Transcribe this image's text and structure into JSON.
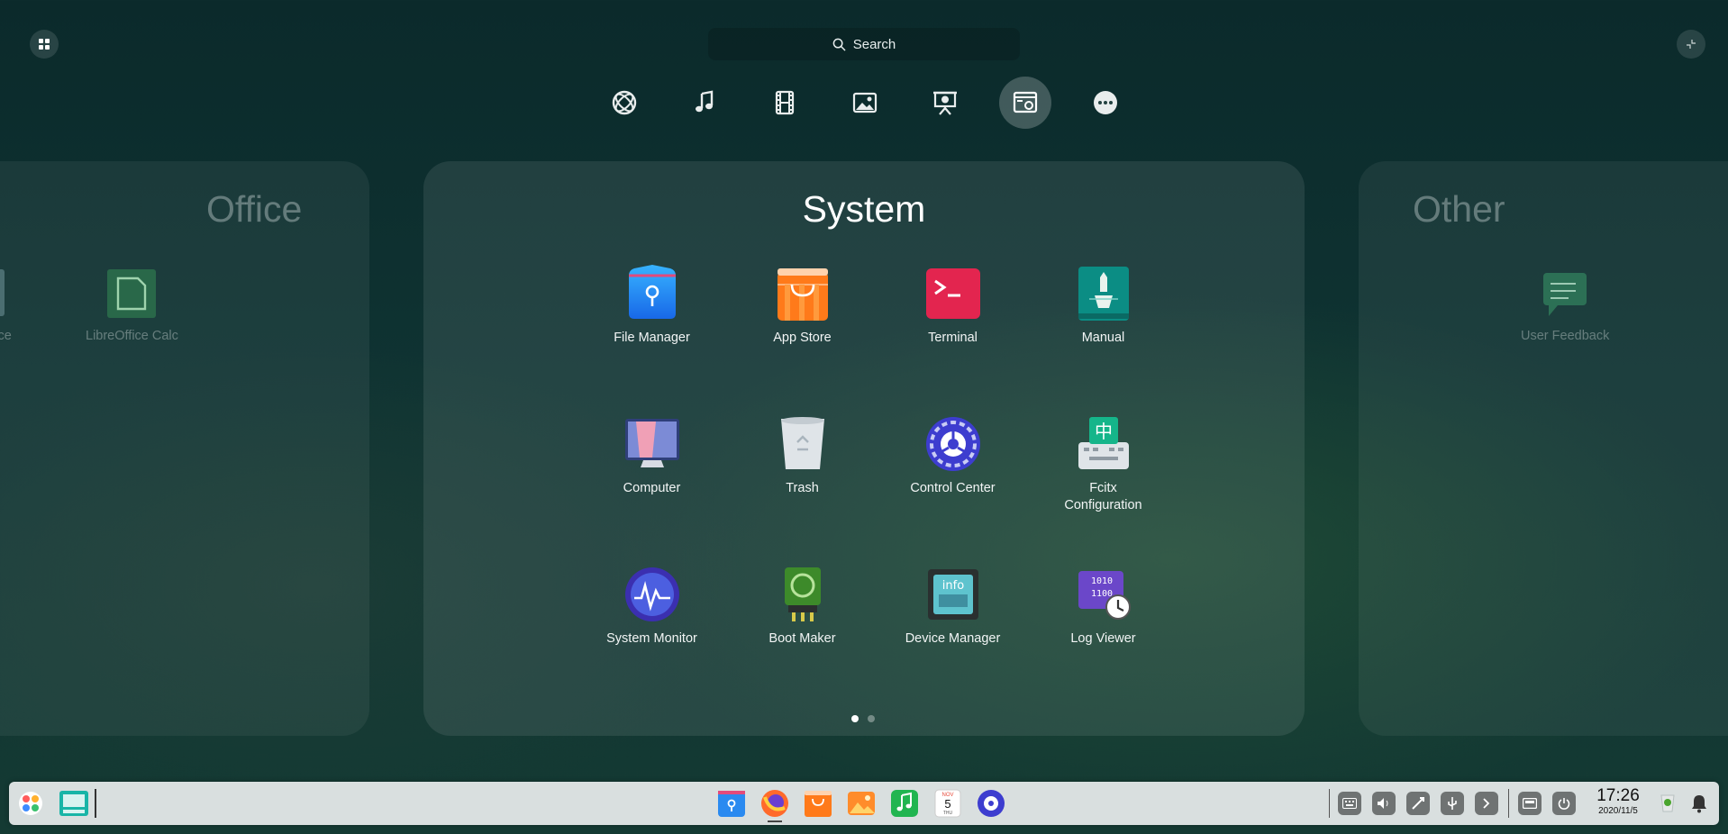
{
  "search": {
    "label": "Search"
  },
  "categories": [
    {
      "name": "internet",
      "icon": "globe-icon"
    },
    {
      "name": "music",
      "icon": "music-note-icon"
    },
    {
      "name": "video",
      "icon": "film-icon"
    },
    {
      "name": "graphics",
      "icon": "image-icon"
    },
    {
      "name": "office",
      "icon": "presentation-icon"
    },
    {
      "name": "system",
      "icon": "system-window-icon",
      "active": true
    },
    {
      "name": "other",
      "icon": "more-icon"
    }
  ],
  "panels": {
    "left": {
      "title": "Office",
      "apps": [
        "Office",
        "LibreOffice Calc"
      ]
    },
    "center": {
      "title": "System",
      "apps": [
        {
          "label": "File Manager",
          "icon": "file-manager-icon"
        },
        {
          "label": "App Store",
          "icon": "app-store-icon"
        },
        {
          "label": "Terminal",
          "icon": "terminal-icon"
        },
        {
          "label": "Manual",
          "icon": "manual-icon"
        },
        {
          "label": "Computer",
          "icon": "computer-icon"
        },
        {
          "label": "Trash",
          "icon": "trash-icon"
        },
        {
          "label": "Control Center",
          "icon": "control-center-icon"
        },
        {
          "label": "Fcitx\nConfiguration",
          "icon": "fcitx-icon"
        },
        {
          "label": "System Monitor",
          "icon": "system-monitor-icon"
        },
        {
          "label": "Boot Maker",
          "icon": "boot-maker-icon"
        },
        {
          "label": "Device Manager",
          "icon": "device-manager-icon"
        },
        {
          "label": "Log Viewer",
          "icon": "log-viewer-icon"
        }
      ],
      "pages": 2,
      "current_page": 1
    },
    "right": {
      "title": "Other",
      "apps": [
        "User Feedback"
      ]
    }
  },
  "dock": {
    "clock_time": "17:26",
    "clock_date": "2020/11/5",
    "calendar_month": "NOV",
    "calendar_day": "5",
    "calendar_weekday": "THU"
  },
  "colors": {
    "active_category_bg": "#ffffff38",
    "dock_bg": "#e8eced"
  }
}
